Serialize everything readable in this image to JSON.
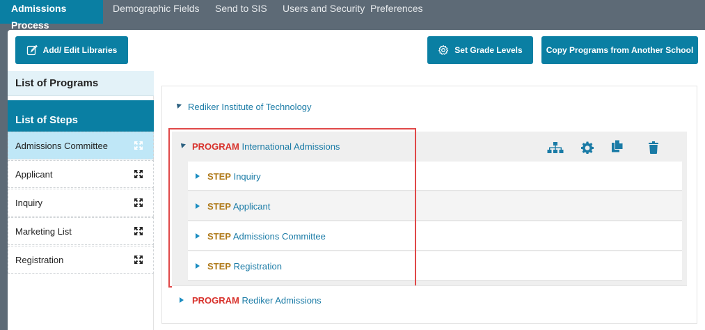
{
  "nav": {
    "tabs": [
      {
        "label": "Admissions Process",
        "active": true
      },
      {
        "label": "Demographic Fields"
      },
      {
        "label": "Send to SIS"
      },
      {
        "label": "Users and Security"
      },
      {
        "label": "Preferences"
      }
    ]
  },
  "toolbar": {
    "add_edit_libraries": "Add/ Edit Libraries",
    "set_grade_levels": "Set Grade Levels",
    "copy_programs": "Copy Programs from Another School"
  },
  "sidebar": {
    "programs_header": "List of Programs",
    "steps_header": "List of Steps",
    "steps": [
      {
        "label": "Admissions Committee",
        "selected": true
      },
      {
        "label": "Applicant"
      },
      {
        "label": "Inquiry"
      },
      {
        "label": "Marketing List"
      },
      {
        "label": "Registration"
      }
    ]
  },
  "tree": {
    "root": "Rediker Institute of Technology",
    "program_keyword": "PROGRAM",
    "step_keyword": "STEP",
    "programs": [
      {
        "name": "International Admissions",
        "expanded": true,
        "steps": [
          "Inquiry",
          "Applicant",
          "Admissions Committee",
          "Registration"
        ]
      },
      {
        "name": "Rediker Admissions",
        "expanded": false
      }
    ]
  },
  "colors": {
    "accent": "#0a7fa3",
    "program_keyword": "#d8322c",
    "step_keyword": "#b07a1a",
    "highlight": "#e04848"
  }
}
